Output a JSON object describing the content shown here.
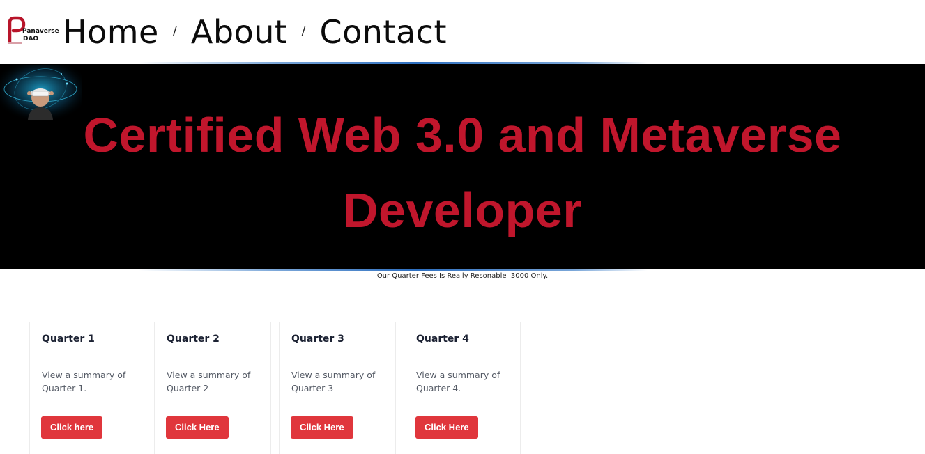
{
  "logo": {
    "line1": "Panaverse",
    "line2": "DAO",
    "icon": "panaverse-p-logo-icon"
  },
  "nav": {
    "items": [
      {
        "label": "Home"
      },
      {
        "label": "About"
      },
      {
        "label": "Contact"
      }
    ],
    "separator": "/"
  },
  "hero": {
    "title": "Certified Web 3.0 and Metaverse Developer",
    "image": "vr-headset-person-image",
    "title_color": "#c0162c",
    "background": "#000000"
  },
  "fees_text": "Our Quarter Fees Is Really Resonable  3000 Only.",
  "cards": [
    {
      "title": "Quarter 1",
      "desc": "View a summary of Quarter 1.",
      "button": "Click here"
    },
    {
      "title": "Quarter 2",
      "desc": "View a summary of Quarter 2",
      "button": "Click Here"
    },
    {
      "title": "Quarter 3",
      "desc": "View a summary of Quarter 3",
      "button": "Click Here"
    },
    {
      "title": "Quarter 4",
      "desc": "View a summary of Quarter 4.",
      "button": "Click Here"
    }
  ],
  "colors": {
    "accent": "#e0363c",
    "brand_red": "#c0162c"
  }
}
